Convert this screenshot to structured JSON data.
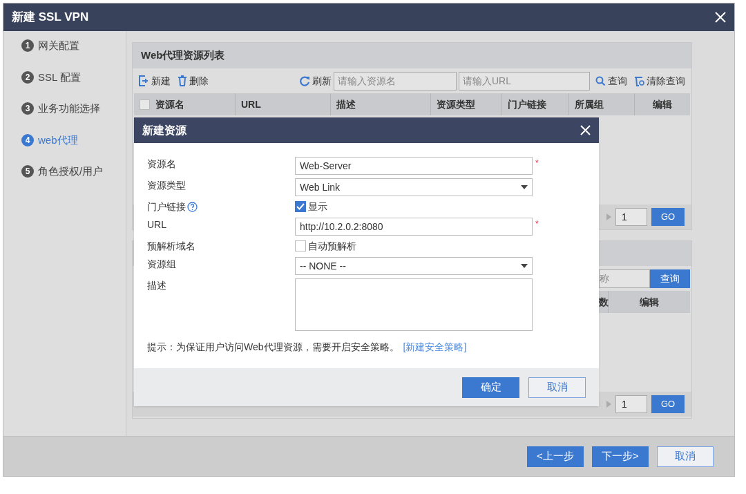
{
  "window": {
    "title": "新建 SSL VPN"
  },
  "steps": [
    {
      "number": "1",
      "label": "网关配置",
      "selected": false
    },
    {
      "number": "2",
      "label": "SSL 配置",
      "selected": false
    },
    {
      "number": "3",
      "label": "业务功能选择",
      "selected": false
    },
    {
      "number": "4",
      "label": "web代理",
      "selected": true
    },
    {
      "number": "5",
      "label": "角色授权/用户",
      "selected": false
    }
  ],
  "resource_list": {
    "title": "Web代理资源列表",
    "new": "新建",
    "delete": "删除",
    "refresh": "刷新",
    "name_placeholder": "请输入资源名",
    "url_placeholder": "请输入URL",
    "query": "查询",
    "clear_query": "清除查询",
    "select_all_checked": false,
    "columns": [
      "资源名",
      "URL",
      "描述",
      "资源类型",
      "门户链接",
      "所属组",
      "编辑"
    ],
    "page_input": "1",
    "go": "GO"
  },
  "second_panel": {
    "search_placeholder": "称",
    "query": "查询",
    "columns": [
      "数",
      "编辑"
    ],
    "page_input": "1",
    "go": "GO"
  },
  "dialog": {
    "title": "新建资源",
    "fields": [
      {
        "kind": "text",
        "label": "资源名",
        "value": "Web-Server",
        "required_mark": "*"
      },
      {
        "kind": "select",
        "label": "资源类型",
        "value": "Web Link"
      },
      {
        "kind": "checkbox",
        "label": "门户链接",
        "help": true,
        "option": "显示",
        "checked": true
      },
      {
        "kind": "text",
        "label": "URL",
        "value": "http://10.2.0.2:8080",
        "required_mark": "*"
      },
      {
        "kind": "checkbox",
        "label": "预解析域名",
        "option": "自动预解析",
        "checked": false
      },
      {
        "kind": "select",
        "label": "资源组",
        "value": "-- NONE --"
      },
      {
        "kind": "textarea",
        "label": "描述"
      }
    ],
    "hint": "提示：为保证用户访问Web代理资源，需要开启安全策略。",
    "hint_link": "[新建安全策略]",
    "buttons": [
      {
        "label": "确定",
        "kind": "primary"
      },
      {
        "label": "取消",
        "kind": "secondary"
      }
    ]
  },
  "footer_buttons": [
    {
      "label": "<上一步",
      "kind": "primary"
    },
    {
      "label": "下一步>",
      "kind": "primary"
    },
    {
      "label": "取消",
      "kind": "secondary"
    }
  ]
}
